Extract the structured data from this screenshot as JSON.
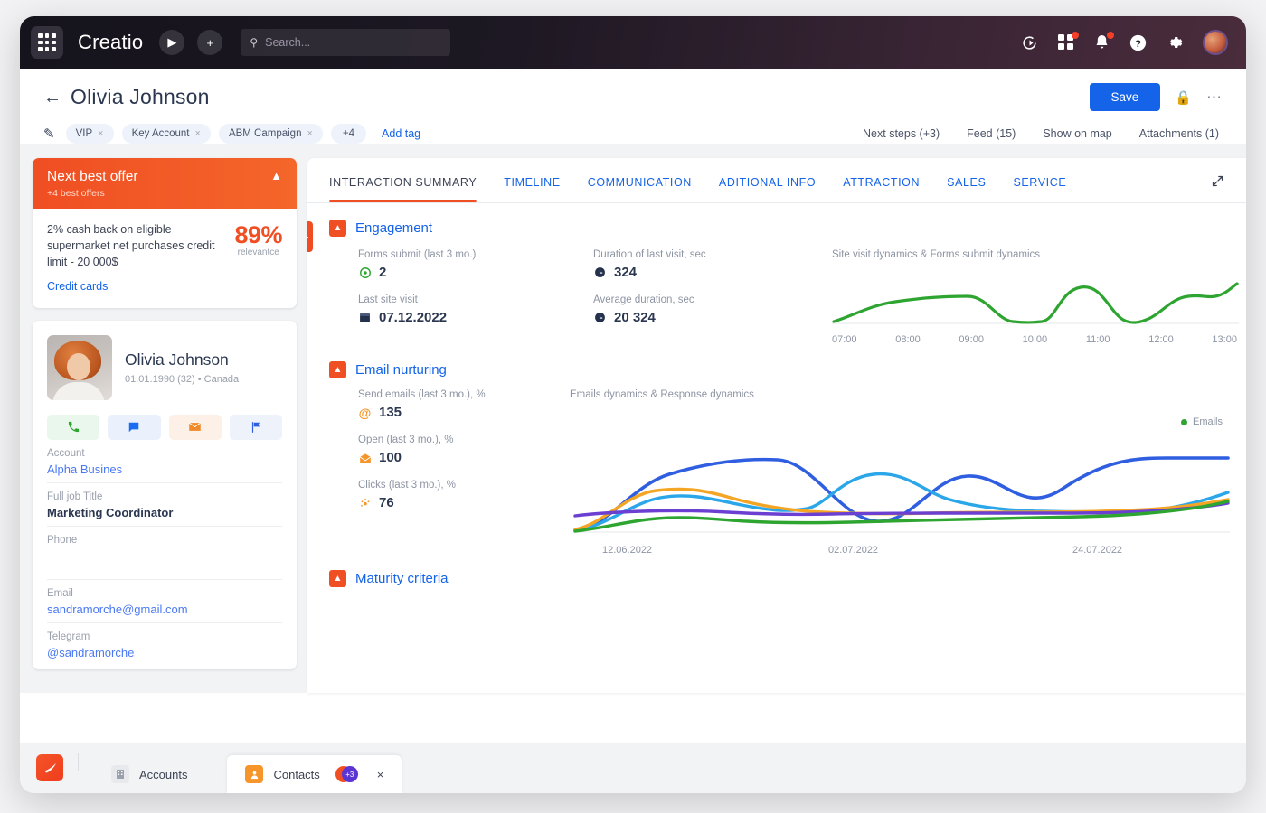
{
  "topbar": {
    "brand": "Creatio",
    "apps_icon": "apps-grid-icon",
    "play_icon": "play-icon",
    "add_icon": "plus-icon",
    "search_placeholder": "Search...",
    "search_icon": "search-icon",
    "right_icons": [
      {
        "name": "ai-assistant-icon",
        "glyph": "↻",
        "badge": false
      },
      {
        "name": "apps-dashboard-icon",
        "glyph": "▒",
        "badge": true
      },
      {
        "name": "notifications-bell-icon",
        "glyph": "🔔",
        "badge": true
      },
      {
        "name": "help-icon",
        "glyph": "?",
        "badge": false
      },
      {
        "name": "settings-gear-icon",
        "glyph": "⚙",
        "badge": false
      }
    ]
  },
  "header": {
    "back_label": "←",
    "title": "Olivia Johnson",
    "save_label": "Save",
    "lock_icon": "lock-icon",
    "more_icon": "more-options-icon",
    "tags": [
      {
        "label": "VIP",
        "close": "×"
      },
      {
        "label": "Key Account",
        "close": "×"
      },
      {
        "label": "ABM Campaign",
        "close": "×"
      }
    ],
    "tags_more": "+4",
    "add_tag": "Add tag",
    "links": [
      "Next steps (+3)",
      "Feed (15)",
      "Show on map",
      "Attachments (1)"
    ]
  },
  "next_best_offer": {
    "title": "Next best offer",
    "subtitle": "+4 best offers",
    "collapse_icon": "chevron-up-icon",
    "offer_text": "2% cash back on eligible supermarket net purchases credit limit - 20 000$",
    "offer_link": "Credit cards",
    "relevance_value": "89%",
    "relevance_label": "relevantce",
    "accent_color": "#f04e23"
  },
  "profile": {
    "name": "Olivia Johnson",
    "meta": "01.01.1990 (32) • Canada",
    "avatar_name": "contact-photo",
    "actions": [
      {
        "name": "call-action-button",
        "icon": "phone-icon",
        "glyph": "✆"
      },
      {
        "name": "chat-action-button",
        "icon": "chat-icon",
        "glyph": "■"
      },
      {
        "name": "email-action-button",
        "icon": "envelope-icon",
        "glyph": "✉"
      },
      {
        "name": "flag-action-button",
        "icon": "flag-icon",
        "glyph": "⚑"
      }
    ],
    "fields": [
      {
        "label": "Account",
        "value": "Alpha Busines",
        "style": "link"
      },
      {
        "label": "Full job Title",
        "value": "Marketing Coordinator",
        "style": "bold"
      },
      {
        "label": "Phone",
        "value": "",
        "style": "plain"
      },
      {
        "label": "Email",
        "value": "sandramorche@gmail.com",
        "style": "mail-link"
      },
      {
        "label": "Telegram",
        "value": "@sandramorche",
        "style": "mail-link"
      }
    ]
  },
  "tabs": [
    {
      "label": "INTERACTION SUMMARY",
      "active": true
    },
    {
      "label": "TIMELINE",
      "active": false
    },
    {
      "label": "COMMUNICATION",
      "active": false
    },
    {
      "label": "ADITIONAL INFO",
      "active": false
    },
    {
      "label": "ATTRACTION",
      "active": false
    },
    {
      "label": "SALES",
      "active": false
    },
    {
      "label": "SERVICE",
      "active": false
    }
  ],
  "expand_icon": "expand-diagonal-icon",
  "side_toggle_icon": "chevron-right-icon",
  "sections": {
    "engagement": {
      "title": "Engagement",
      "kpis": [
        {
          "label": "Forms submit (last 3 mo.)",
          "value": "2",
          "icon": "form-submit-icon",
          "glyph": "⊙",
          "color": "#2ea531"
        },
        {
          "label": "Last site visit",
          "value": "07.12.2022",
          "icon": "calendar-icon",
          "glyph": "▤",
          "color": "#2b3750"
        },
        {
          "label": "Duration of last visit, sec",
          "value": "324",
          "icon": "clock-icon",
          "glyph": "◕",
          "color": "#24314d"
        },
        {
          "label": "Average duration, sec",
          "value": "20 324",
          "icon": "clock-icon",
          "glyph": "◕",
          "color": "#24314d"
        }
      ]
    },
    "email_nurturing": {
      "title": "Email nurturing",
      "kpis": [
        {
          "label": "Send emails (last 3 mo.), %",
          "value": "135",
          "icon": "at-sign-icon",
          "glyph": "@",
          "color": "#f5952a"
        },
        {
          "label": "Open (last 3 mo.), %",
          "value": "100",
          "icon": "open-envelope-icon",
          "glyph": "✉",
          "color": "#f5952a"
        },
        {
          "label": "Clicks (last 3 mo.), %",
          "value": "76",
          "icon": "click-burst-icon",
          "glyph": "✦",
          "color": "#f5952a"
        }
      ]
    },
    "maturity": {
      "title": "Maturity criteria"
    }
  },
  "chart_data": [
    {
      "type": "line",
      "title": "Site visit dynamics & Forms submit dynamics",
      "xlabel": "",
      "ylabel": "",
      "grid": false,
      "legend": "none",
      "x": [
        "07:00",
        "08:00",
        "09:00",
        "10:00",
        "11:00",
        "12:00",
        "13:00"
      ],
      "series": [
        {
          "name": "Site visits",
          "color": "#2ea531",
          "values": [
            8,
            26,
            38,
            39,
            6,
            4,
            44,
            58,
            20,
            3,
            40,
            50,
            48,
            56,
            66
          ]
        }
      ],
      "ylim": [
        0,
        100
      ]
    },
    {
      "type": "line",
      "title": "Emails dynamics & Response dynamics",
      "xlabel": "",
      "ylabel": "",
      "grid": false,
      "legend": "top-right",
      "legend_entries": [
        {
          "label": "Emails",
          "color": "#2ea531"
        }
      ],
      "x": [
        "12.06.2022",
        "02.07.2022",
        "24.07.2022"
      ],
      "series": [
        {
          "name": "Series blue",
          "color": "#2f5fe0",
          "values": [
            2,
            30,
            55,
            57,
            40,
            12,
            30,
            55,
            68,
            70,
            70,
            70
          ]
        },
        {
          "name": "Series cyan",
          "color": "#2ba6e8",
          "values": [
            2,
            26,
            28,
            22,
            24,
            44,
            50,
            40,
            24,
            20,
            22,
            38
          ]
        },
        {
          "name": "Series orange",
          "color": "#f5a524",
          "values": [
            3,
            33,
            38,
            33,
            26,
            22,
            21,
            21,
            20,
            20,
            22,
            28
          ]
        },
        {
          "name": "Series purple",
          "color": "#6a3fd1",
          "values": [
            18,
            17,
            21,
            20,
            20,
            21,
            21,
            20,
            20,
            20,
            22,
            25
          ]
        },
        {
          "name": "Series green",
          "color": "#2ea531",
          "values": [
            2,
            10,
            14,
            13,
            12,
            12,
            13,
            14,
            15,
            16,
            19,
            25
          ]
        }
      ],
      "ylim": [
        0,
        100
      ]
    }
  ],
  "bottombar": {
    "logo_icon": "creatio-logo-icon",
    "tabs": [
      {
        "label": "Accounts",
        "icon": "accounts-icon",
        "active": false
      },
      {
        "label": "Contacts",
        "icon": "contacts-icon",
        "active": true
      }
    ],
    "badge": "+3",
    "close_icon": "×"
  }
}
